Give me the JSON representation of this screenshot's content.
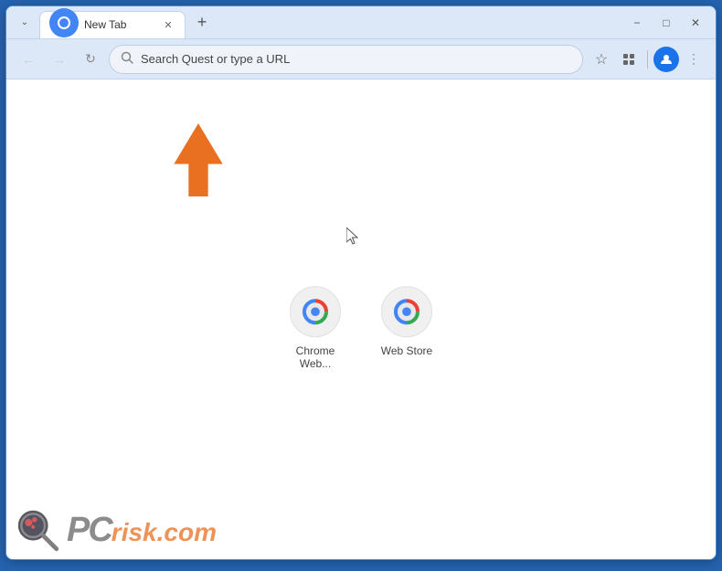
{
  "browser": {
    "tab": {
      "title": "New Tab",
      "favicon": "🌐"
    },
    "window_controls": {
      "minimize": "−",
      "maximize": "□",
      "close": "✕"
    },
    "nav": {
      "back": "←",
      "forward": "→",
      "refresh": "↻",
      "address_placeholder": "Search Quest or type a URL"
    }
  },
  "shortcuts": [
    {
      "label": "Chrome Web...",
      "icon": "chrome"
    },
    {
      "label": "Web Store",
      "icon": "chrome"
    }
  ],
  "watermark": {
    "prefix": "PC",
    "suffix": "risk.com"
  },
  "colors": {
    "accent": "#e87020",
    "border": "#2563b0",
    "tabbar_bg": "#dce8f7"
  }
}
